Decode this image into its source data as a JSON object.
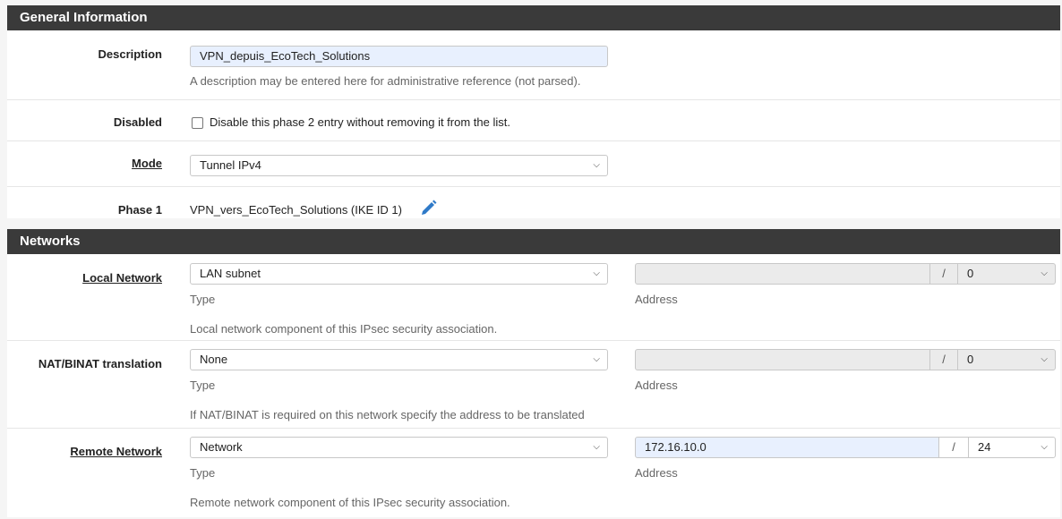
{
  "general": {
    "heading": "General Information",
    "description": {
      "label": "Description",
      "value": "VPN_depuis_EcoTech_Solutions",
      "help": "A description may be entered here for administrative reference (not parsed)."
    },
    "disabled": {
      "label": "Disabled",
      "checkbox_label": "Disable this phase 2 entry without removing it from the list.",
      "checked": false
    },
    "mode": {
      "label": "Mode",
      "value": "Tunnel IPv4"
    },
    "phase1": {
      "label": "Phase 1",
      "value": "VPN_vers_EcoTech_Solutions (IKE ID 1)",
      "icon": "pencil-icon"
    }
  },
  "networks": {
    "heading": "Networks",
    "slash": "/",
    "type_label": "Type",
    "address_label": "Address",
    "local": {
      "label": "Local Network",
      "type_value": "LAN subnet",
      "address_value": "",
      "cidr": "0",
      "help": "Local network component of this IPsec security association."
    },
    "nat": {
      "label": "NAT/BINAT translation",
      "type_value": "None",
      "address_value": "",
      "cidr": "0",
      "help": "If NAT/BINAT is required on this network specify the address to be translated"
    },
    "remote": {
      "label": "Remote Network",
      "type_value": "Network",
      "address_value": "172.16.10.0",
      "cidr": "24",
      "help": "Remote network component of this IPsec security association."
    }
  },
  "colors": {
    "heading_bg": "#3a3a3a",
    "link_blue": "#2f7ac8",
    "highlight_input": "#e8f0fe"
  }
}
